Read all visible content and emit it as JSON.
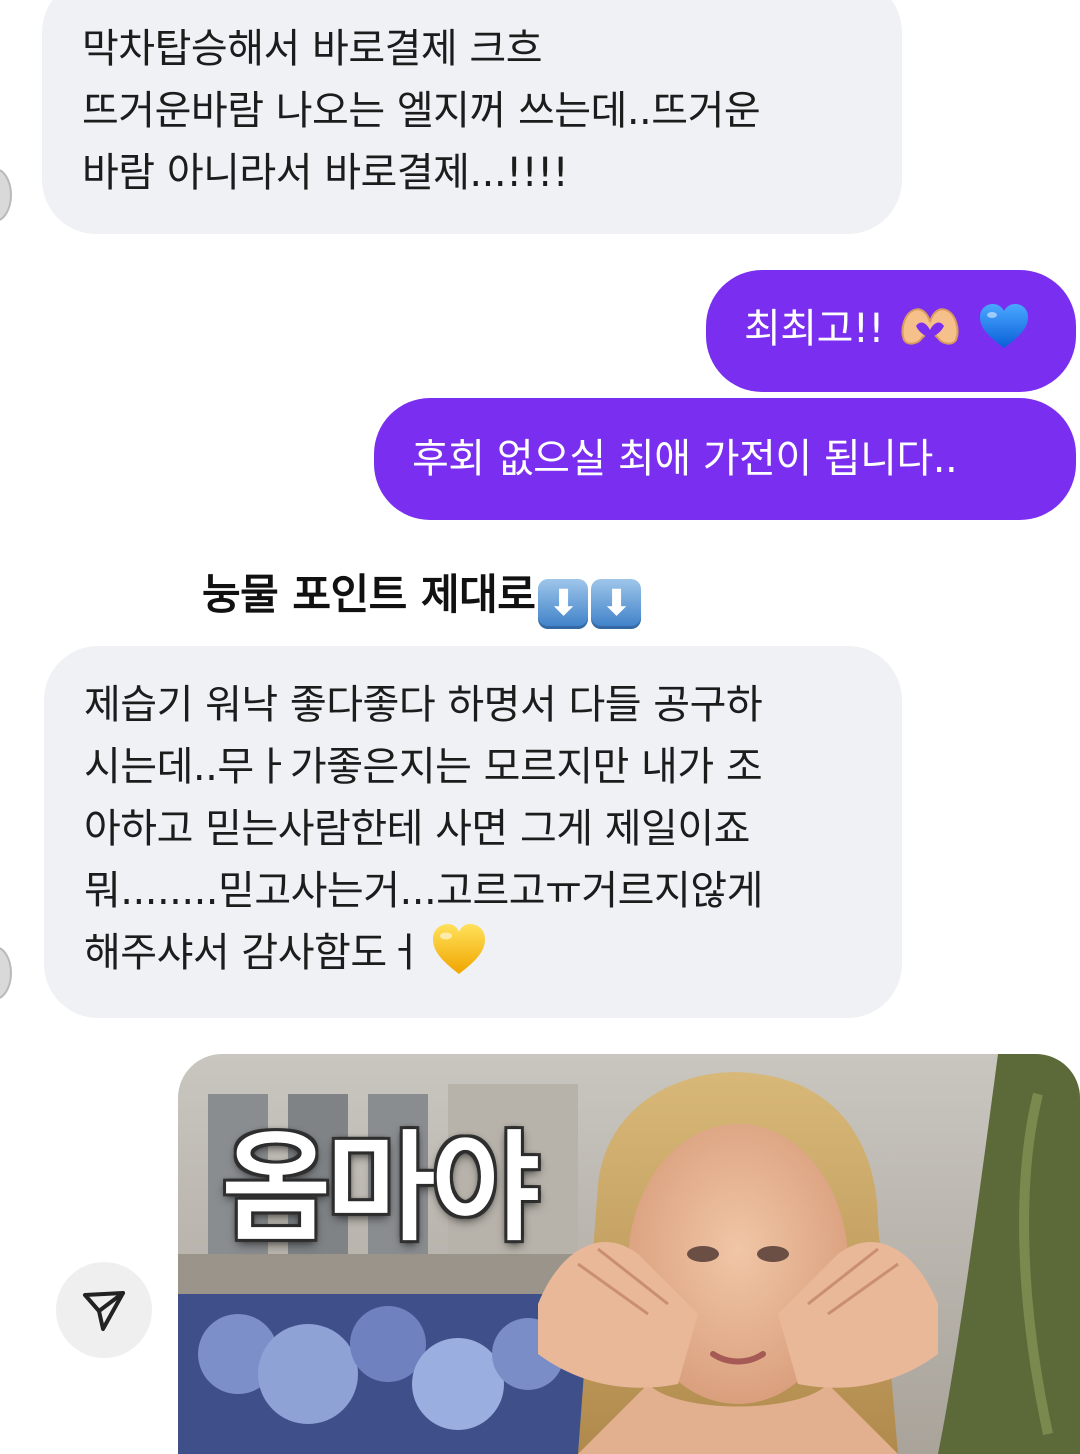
{
  "messages": [
    {
      "direction": "incoming",
      "lines": [
        "막차탑승해서 바로결제 크흐",
        "뜨거운바람 나오는 엘지꺼 쓰는데..뜨거운",
        "바람 아니라서 바로결제...!!!!"
      ]
    },
    {
      "direction": "outgoing",
      "text": "최최고!!",
      "emojis": [
        "heart-hands-emoji",
        "blue-heart-emoji"
      ]
    },
    {
      "direction": "outgoing",
      "text": "후회 없으실 최애 가전이 됩니다.."
    },
    {
      "direction": "incoming",
      "lines": [
        "제습기 워낙 좋다좋다 하명서 다들 공구하",
        "시는데..무ㅏ가좋은지는 모르지만 내가 조",
        "아하고 믿는사람한테 사면 그게 제일이죠",
        "뭐........믿고사는거...고르고ㅠ거르지않게",
        "해주샤서 감사함도ㅓ"
      ],
      "emojis": [
        "yellow-heart-emoji"
      ]
    }
  ],
  "caption": {
    "text": "눙물 포인트 제대로",
    "arrows": [
      "⬇",
      "⬇"
    ]
  },
  "media": {
    "overlay_text": "옴마야",
    "description_icon": "photo-thumbnail"
  },
  "actions": {
    "share_icon": "send-icon"
  },
  "colors": {
    "incoming_bubble": "#eff1f4",
    "outgoing_bubble": "#7a2ff0",
    "outgoing_text": "#ffffff"
  }
}
